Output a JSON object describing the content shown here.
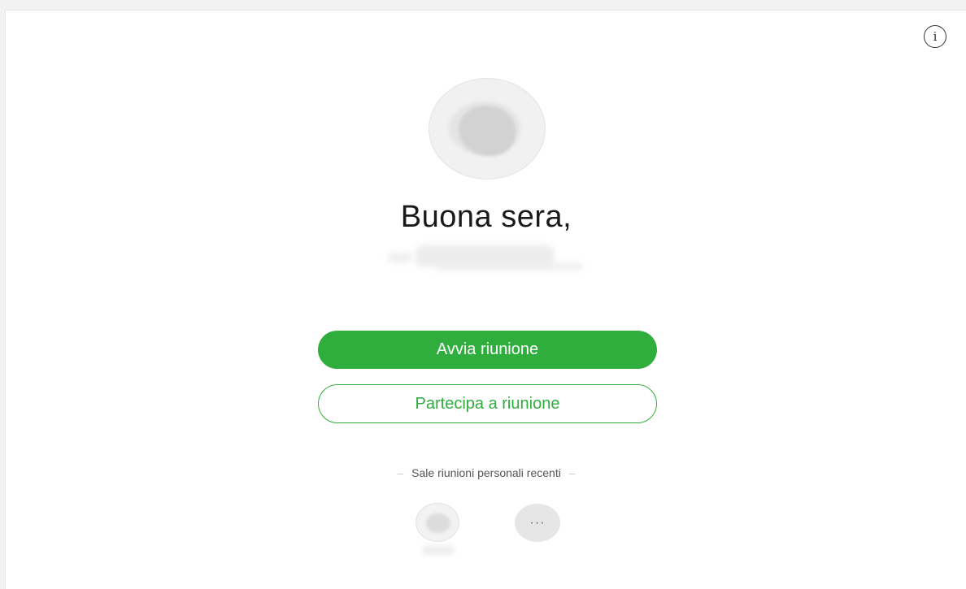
{
  "header": {
    "info_icon": "info-icon",
    "info_glyph": "i"
  },
  "profile": {
    "avatar_icon": "avatar",
    "greeting": "Buona sera,"
  },
  "actions": {
    "start_meeting_label": "Avvia riunione",
    "join_meeting_label": "Partecipa a riunione"
  },
  "recent": {
    "section_label": "Sale riunioni personali recenti",
    "dash_glyph": "–",
    "more_glyph": "···",
    "more_icon": "more-icon"
  },
  "colors": {
    "accent": "#2fae3e",
    "background": "#ffffff",
    "text": "#1a1a1a"
  }
}
